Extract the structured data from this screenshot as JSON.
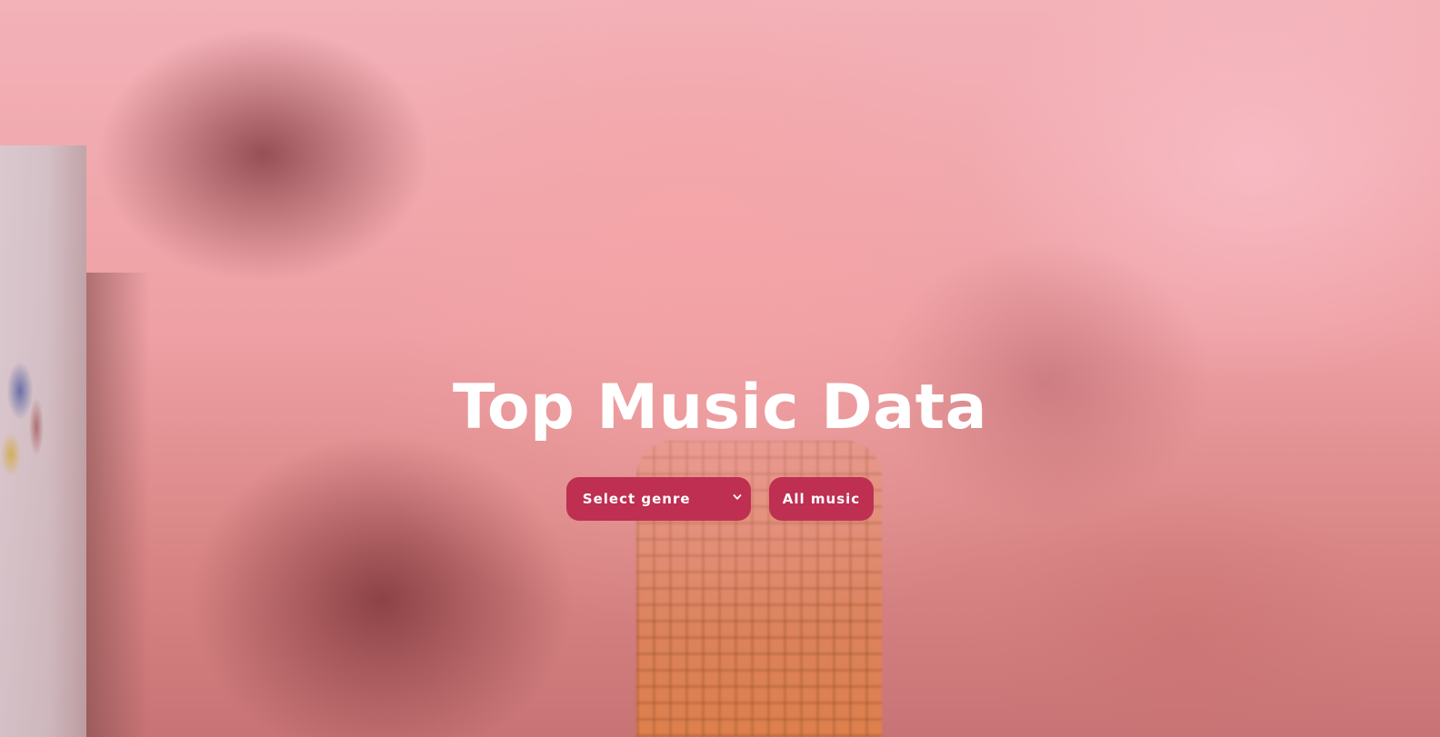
{
  "hero": {
    "title": "Top Music Data",
    "background": "smoke-video-background"
  },
  "controls": {
    "genre_select": {
      "selected": "Select genre",
      "icon": "chevron-down-icon"
    },
    "all_music_label": "All music"
  },
  "colors": {
    "button_bg": "#be2f52",
    "button_text": "#ffffff",
    "title_text": "#ffffff"
  }
}
